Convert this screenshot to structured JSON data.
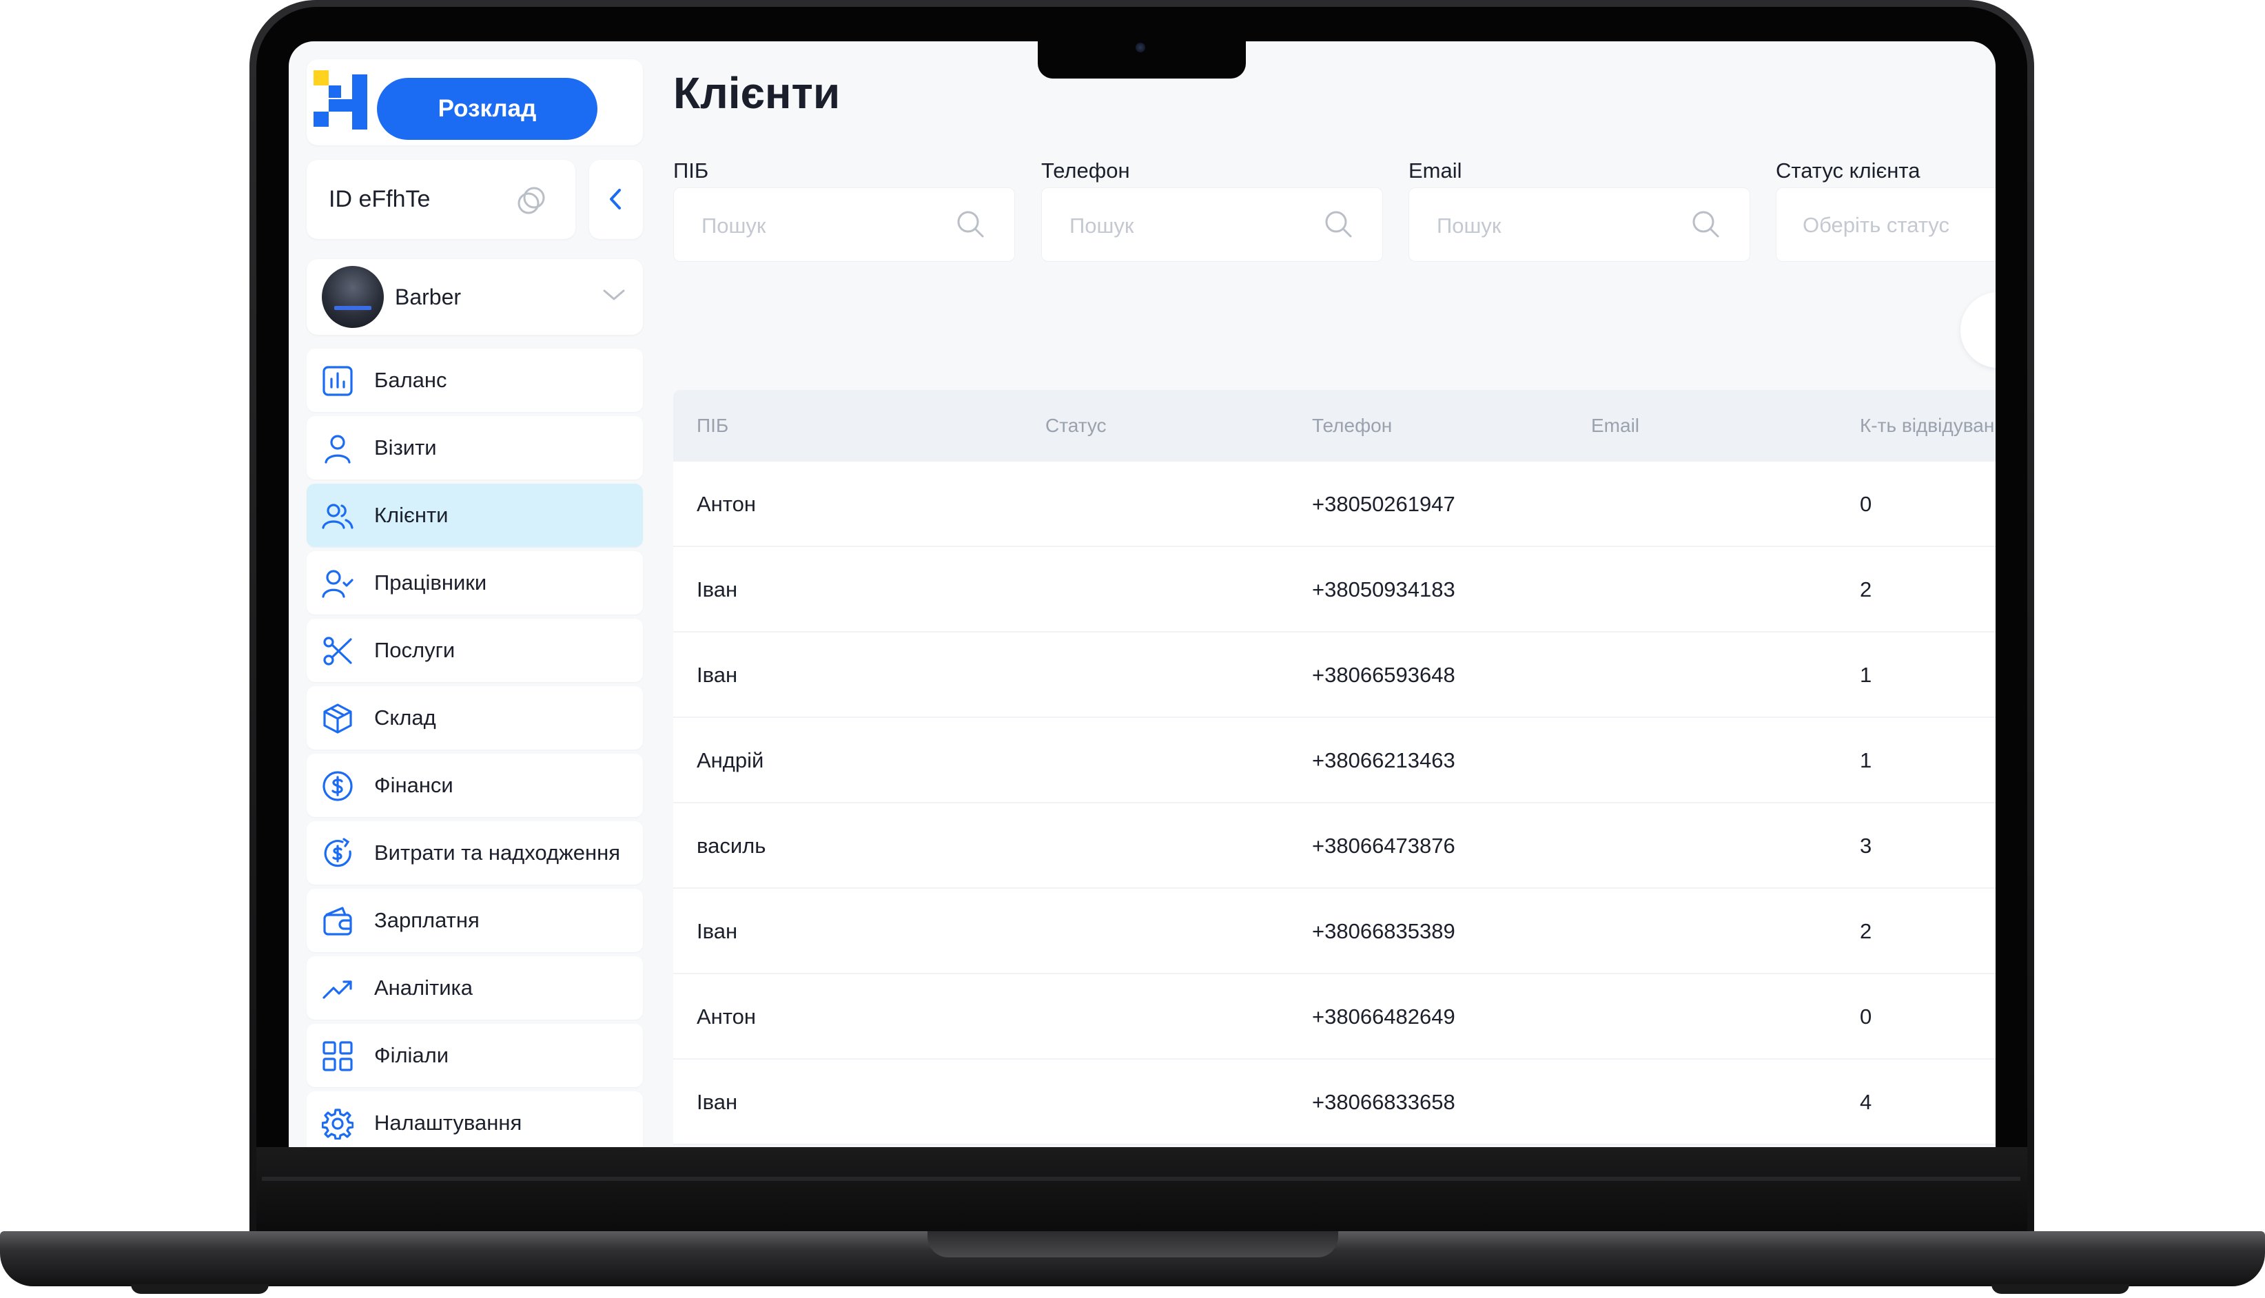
{
  "app": {
    "schedule_button": "Розклад",
    "id_label": "ID eFfhTe",
    "branch_name": "Barber"
  },
  "sidebar": {
    "items": [
      {
        "label": "Баланс",
        "icon": "chart-bar-icon"
      },
      {
        "label": "Візити",
        "icon": "user-icon"
      },
      {
        "label": "Клієнти",
        "icon": "users-icon",
        "active": true
      },
      {
        "label": "Працівники",
        "icon": "user-check-icon"
      },
      {
        "label": "Послуги",
        "icon": "scissors-icon"
      },
      {
        "label": "Склад",
        "icon": "box-icon"
      },
      {
        "label": "Фінанси",
        "icon": "dollar-circle-icon"
      },
      {
        "label": "Витрати та надходження",
        "icon": "dollar-refresh-icon"
      },
      {
        "label": "Зарплатня",
        "icon": "wallet-icon"
      },
      {
        "label": "Аналітика",
        "icon": "trending-up-icon"
      },
      {
        "label": "Філіали",
        "icon": "grid-icon"
      },
      {
        "label": "Налаштування",
        "icon": "gear-icon"
      }
    ]
  },
  "page": {
    "title": "Клієнти"
  },
  "filters": {
    "name": {
      "label": "ПІБ",
      "placeholder": "Пошук"
    },
    "phone": {
      "label": "Телефон",
      "placeholder": "Пошук"
    },
    "email": {
      "label": "Email",
      "placeholder": "Пошук"
    },
    "status": {
      "label": "Статус клієнта",
      "placeholder": "Оберіть статус"
    }
  },
  "table": {
    "columns": [
      "ПІБ",
      "Статус",
      "Телефон",
      "Email",
      "К-ть відвідувань"
    ],
    "rows": [
      {
        "name": "Антон",
        "status": "",
        "phone": "+38050261947",
        "email": "",
        "visits": "0"
      },
      {
        "name": "Іван",
        "status": "",
        "phone": "+38050934183",
        "email": "",
        "visits": "2"
      },
      {
        "name": "Іван",
        "status": "",
        "phone": "+38066593648",
        "email": "",
        "visits": "1"
      },
      {
        "name": "Андрій",
        "status": "",
        "phone": "+38066213463",
        "email": "",
        "visits": "1"
      },
      {
        "name": "василь",
        "status": "",
        "phone": "+38066473876",
        "email": "",
        "visits": "3"
      },
      {
        "name": "Іван",
        "status": "",
        "phone": "+38066835389",
        "email": "",
        "visits": "2"
      },
      {
        "name": "Антон",
        "status": "",
        "phone": "+38066482649",
        "email": "",
        "visits": "0"
      },
      {
        "name": "Іван",
        "status": "",
        "phone": "+38066833658",
        "email": "",
        "visits": "4"
      }
    ]
  },
  "colors": {
    "accent": "#1b6cf2",
    "active_nav": "#d6f1fc",
    "logo_yellow": "#ffd21f",
    "text": "#1a1f2b",
    "muted": "#9aa2ae"
  }
}
